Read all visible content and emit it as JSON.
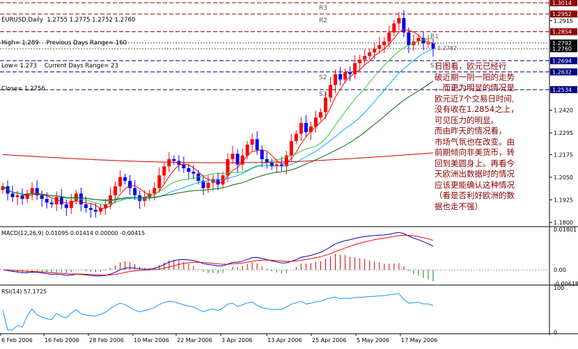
{
  "chart_title": "EURUSD,Daily  1.2755 1.2775 1.2752 1.2760",
  "info_lines": [
    "High= 1.289    Previous Days Range= 160",
    "Low= 1.273    Current Days Range= 23",
    "Close= 1.2756"
  ],
  "pivot_labels": {
    "r3": "R3",
    "r2": "R2",
    "r1": "R1",
    "s1": "S1",
    "s2": "S2",
    "s3": "S3"
  },
  "price_tag": "1.2782",
  "comment_lines": [
    "  日图看，欧元已经行",
    "破近期一阴一阳的走势",
    "，而更为明显的情况是",
    "欧元近7个交易日时间,",
    "没有收在1.2854之上，",
    "可见压力的明显。",
    "  而由昨天的情况看，",
    "市场气氛也在改变。由",
    "前期倾向非美货币，转",
    "回到美圆身上。再看今",
    "天欧洲出数据时的情况",
    "应该更能确认这种情况",
    "（看是否利好欧洲的数",
    "据也走不强）"
  ],
  "price_axis_ticks": [
    "1.2915",
    "1.2420",
    "1.2295",
    "1.2175",
    "1.2050",
    "1.1925",
    "1.1800"
  ],
  "price_highlights": [
    {
      "label": "1.3014",
      "bg": "#8b0000",
      "fg": "#ffffff"
    },
    {
      "label": "1.2952",
      "bg": "#8b0000",
      "fg": "#ffffff"
    },
    {
      "label": "1.2854",
      "bg": "#8b0000",
      "fg": "#ffffff"
    },
    {
      "label": "1.2792",
      "bg": "#000000",
      "fg": "#ffffff"
    },
    {
      "label": "1.2760",
      "bg": "#000000",
      "fg": "#ffffff"
    },
    {
      "label": "1.2694",
      "bg": "#000080",
      "fg": "#ffffff"
    },
    {
      "label": "1.2632",
      "bg": "#000080",
      "fg": "#ffffff"
    },
    {
      "label": "1.2534",
      "bg": "#000080",
      "fg": "#ffffff"
    }
  ],
  "macd_title": "MACD(12,26,9) 0.01095 0.01414 0.00000 -0.00415",
  "macd_ticks": [
    "0.01801",
    "0.00",
    "-0.00618"
  ],
  "rsi_title": "RSI(14) 57.1725",
  "rsi_ticks": [
    "100",
    "0"
  ],
  "date_labels": [
    "6 Feb 2006",
    "16 Feb 2006",
    "28 Feb 2006",
    "10 Mar 2006",
    "22 Mar 2006",
    "3 Apr 2006",
    "13 Apr 2006",
    "25 Apr 2006",
    "5 May 2006",
    "17 May 2006"
  ],
  "colors": {
    "bull": "#ff0000",
    "bear": "#0000ff",
    "ma_fast": "#ff0000",
    "ma_mid": "#33cc33",
    "ma_slow": "#00aaff",
    "ma_long": "#006600",
    "ma_200": "#cc0000",
    "macd_line": "#0000cc",
    "macd_signal": "#ff0000",
    "rsi": "#1e90ff",
    "comment": "#8b0000"
  },
  "chart_data": {
    "type": "candlestick",
    "symbol": "EURUSD",
    "timeframe": "Daily",
    "x": [
      "6 Feb 2006",
      "16 Feb 2006",
      "28 Feb 2006",
      "10 Mar 2006",
      "22 Mar 2006",
      "3 Apr 2006",
      "13 Apr 2006",
      "25 Apr 2006",
      "5 May 2006",
      "17 May 2006"
    ],
    "price_ylim": [
      1.18,
      1.3014
    ],
    "candles_close": [
      1.2,
      1.196,
      1.194,
      1.195,
      1.193,
      1.196,
      1.199,
      1.195,
      1.193,
      1.191,
      1.19,
      1.194,
      1.19,
      1.188,
      1.192,
      1.196,
      1.19,
      1.188,
      1.187,
      1.186,
      1.188,
      1.19,
      1.195,
      1.2,
      1.205,
      1.203,
      1.199,
      1.195,
      1.192,
      1.194,
      1.196,
      1.199,
      1.206,
      1.211,
      1.215,
      1.214,
      1.212,
      1.21,
      1.208,
      1.207,
      1.203,
      1.199,
      1.202,
      1.204,
      1.201,
      1.206,
      1.215,
      1.218,
      1.212,
      1.217,
      1.223,
      1.226,
      1.22,
      1.215,
      1.213,
      1.211,
      1.212,
      1.211,
      1.217,
      1.225,
      1.229,
      1.235,
      1.23,
      1.233,
      1.238,
      1.241,
      1.249,
      1.256,
      1.262,
      1.259,
      1.263,
      1.262,
      1.268,
      1.27,
      1.272,
      1.274,
      1.276,
      1.278,
      1.28,
      1.285,
      1.29,
      1.293,
      1.285,
      1.278,
      1.28,
      1.282,
      1.279,
      1.279,
      1.276
    ],
    "resistance_levels": [
      1.3014,
      1.2952,
      1.2854
    ],
    "support_levels": [
      1.2694,
      1.2632,
      1.2534
    ],
    "current_levels": [
      1.2792,
      1.276
    ],
    "macd": {
      "params": "12,26,9",
      "values": [
        0.01095,
        0.01414,
        0.0,
        -0.00415
      ],
      "ylim": [
        -0.00618,
        0.01801
      ]
    },
    "rsi": {
      "period": 14,
      "value": 57.1725,
      "ylim": [
        0,
        100
      ]
    }
  }
}
